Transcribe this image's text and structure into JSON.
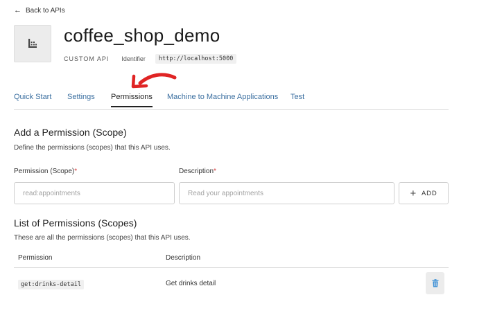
{
  "nav": {
    "back_label": "Back to APIs"
  },
  "api": {
    "name": "coffee_shop_demo",
    "type": "CUSTOM API",
    "identifier_label": "Identifier",
    "identifier_value": "http://localhost:5000"
  },
  "tabs": [
    {
      "label": "Quick Start",
      "active": false
    },
    {
      "label": "Settings",
      "active": false
    },
    {
      "label": "Permissions",
      "active": true
    },
    {
      "label": "Machine to Machine Applications",
      "active": false
    },
    {
      "label": "Test",
      "active": false
    }
  ],
  "add_permission": {
    "title": "Add a Permission (Scope)",
    "subtitle": "Define the permissions (scopes) that this API uses.",
    "scope_label": "Permission (Scope)",
    "scope_placeholder": "read:appointments",
    "description_label": "Description",
    "description_placeholder": "Read your appointments",
    "required_mark": "*",
    "add_label": "ADD"
  },
  "permissions_list": {
    "title": "List of Permissions (Scopes)",
    "subtitle": "These are all the permissions (scopes) that this API uses.",
    "columns": [
      "Permission",
      "Description"
    ],
    "rows": [
      {
        "permission": "get:drinks-detail",
        "description": "Get drinks detail"
      }
    ]
  },
  "colors": {
    "tab_link": "#3b6fa0",
    "required": "#d64242",
    "delete_icon": "#3a8fd6",
    "annotation_arrow": "#e02424"
  },
  "icons": {
    "back": "arrow-left-icon",
    "api_logo": "building-icon",
    "add": "plus-icon",
    "delete": "trash-icon"
  }
}
